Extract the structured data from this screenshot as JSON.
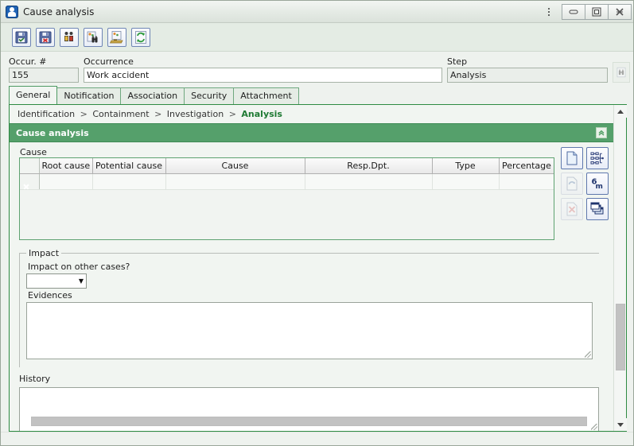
{
  "window": {
    "title": "Cause analysis",
    "app_icon": "app-logo-icon",
    "controls": {
      "menu": "window-menu-icon",
      "minimize": "minimize-icon",
      "maximize": "maximize-icon",
      "close": "close-icon"
    }
  },
  "toolbar": {
    "buttons": [
      {
        "name": "save-button",
        "icon": "floppy-save-icon",
        "title": "Save"
      },
      {
        "name": "save-close-button",
        "icon": "floppy-delete-icon",
        "title": "Save and close"
      },
      {
        "name": "team-button",
        "icon": "people-icon",
        "title": "Team"
      },
      {
        "name": "search-button",
        "icon": "binoculars-page-icon",
        "title": "Search"
      },
      {
        "name": "report-button",
        "icon": "report-page-icon",
        "title": "Report"
      },
      {
        "name": "refresh-button",
        "icon": "refresh-arrows-icon",
        "title": "Refresh"
      }
    ]
  },
  "header": {
    "occurrence_number": {
      "label": "Occur. #",
      "value": "155"
    },
    "occurrence": {
      "label": "Occurrence",
      "value": "Work accident"
    },
    "step": {
      "label": "Step",
      "value": "Analysis"
    },
    "lookup_button": {
      "name": "occurrence-lookup-button",
      "icon": "binoculars-page-icon"
    }
  },
  "tabs": [
    {
      "label": "General",
      "active": true
    },
    {
      "label": "Notification",
      "active": false
    },
    {
      "label": "Association",
      "active": false
    },
    {
      "label": "Security",
      "active": false
    },
    {
      "label": "Attachment",
      "active": false
    }
  ],
  "breadcrumb": {
    "separator": ">",
    "items": [
      {
        "label": "Identification",
        "current": false
      },
      {
        "label": "Containment",
        "current": false
      },
      {
        "label": "Investigation",
        "current": false
      },
      {
        "label": "Analysis",
        "current": true
      }
    ]
  },
  "section": {
    "title": "Cause analysis",
    "collapse_button": "collapse-section-button"
  },
  "cause": {
    "group_label": "Cause",
    "columns": [
      "",
      "Root cause",
      "Potential cause",
      "Cause",
      "Resp.Dpt.",
      "Type",
      "Percentage"
    ],
    "rows": [
      {
        "marker": "record-indicator-icon",
        "root_cause": "",
        "potential_cause": "",
        "cause": "",
        "resp_dpt": "",
        "type": "",
        "percentage": ""
      }
    ],
    "side_buttons": [
      {
        "name": "new-cause-button",
        "icon": "new-document-icon",
        "disabled": false
      },
      {
        "name": "fishbone-diagram-button",
        "icon": "tree-diagram-icon",
        "disabled": false
      },
      {
        "name": "edit-cause-button",
        "icon": "edit-arrow-icon",
        "disabled": true
      },
      {
        "name": "six-m-method-button",
        "icon": "six-m-icon",
        "disabled": false,
        "label": "6m"
      },
      {
        "name": "delete-cause-button",
        "icon": "delete-x-icon",
        "disabled": true
      },
      {
        "name": "cascade-windows-button",
        "icon": "cascade-icon",
        "disabled": false
      }
    ]
  },
  "impact": {
    "legend": "Impact",
    "question_label": "Impact on other cases?",
    "select_value": "",
    "evidences_label": "Evidences",
    "evidences_value": ""
  },
  "history": {
    "label": "History",
    "value": ""
  },
  "colors": {
    "accent_green": "#55a06b",
    "panel_border": "#2e8b42",
    "current_crumb": "#1e7a33",
    "window_bg": "#eef2ee"
  }
}
